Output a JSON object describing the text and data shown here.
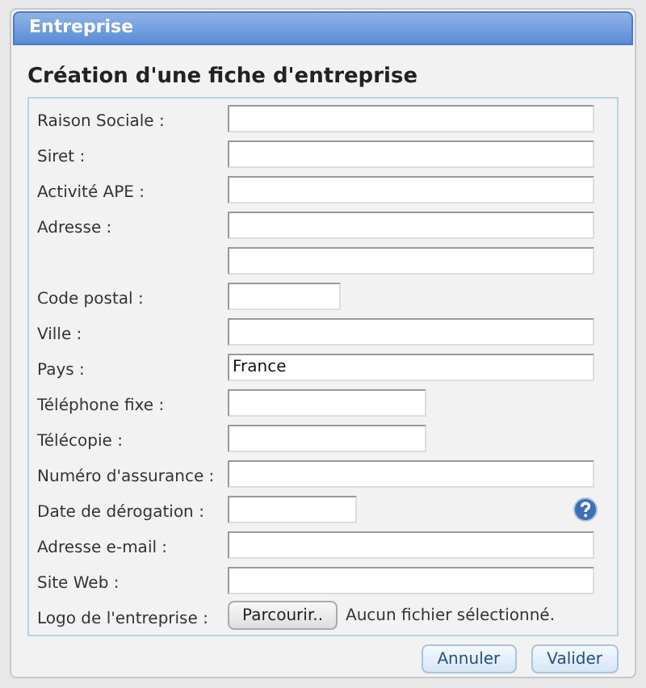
{
  "panel": {
    "title": "Entreprise"
  },
  "heading": "Création d'une fiche d'entreprise",
  "fields": [
    {
      "label": "Raison Sociale :",
      "kind": "long"
    },
    {
      "label": "Siret :",
      "kind": "long"
    },
    {
      "label": "Activité APE :",
      "kind": "long"
    },
    {
      "label": "Adresse :",
      "kind": "long"
    },
    {
      "kind": "long"
    },
    {
      "label": "Code postal :",
      "kind": "short"
    },
    {
      "label": "Ville :",
      "kind": "long"
    },
    {
      "label": "Pays :",
      "kind": "long",
      "value": "France"
    },
    {
      "label": "Téléphone fixe :",
      "kind": "medium"
    },
    {
      "label": "Télécopie :",
      "kind": "medium"
    },
    {
      "label": "Numéro d'assurance :",
      "kind": "long"
    },
    {
      "label": "Date de dérogation :",
      "kind": "date",
      "help": true
    },
    {
      "label": "Adresse e-mail :",
      "kind": "long"
    },
    {
      "label": "Site Web :",
      "kind": "long"
    },
    {
      "label": "Logo de l'entreprise :",
      "kind": "file",
      "button": "Parcourir..",
      "status": "Aucun fichier sélectionné."
    }
  ],
  "buttons": [
    "Annuler",
    "Valider"
  ]
}
